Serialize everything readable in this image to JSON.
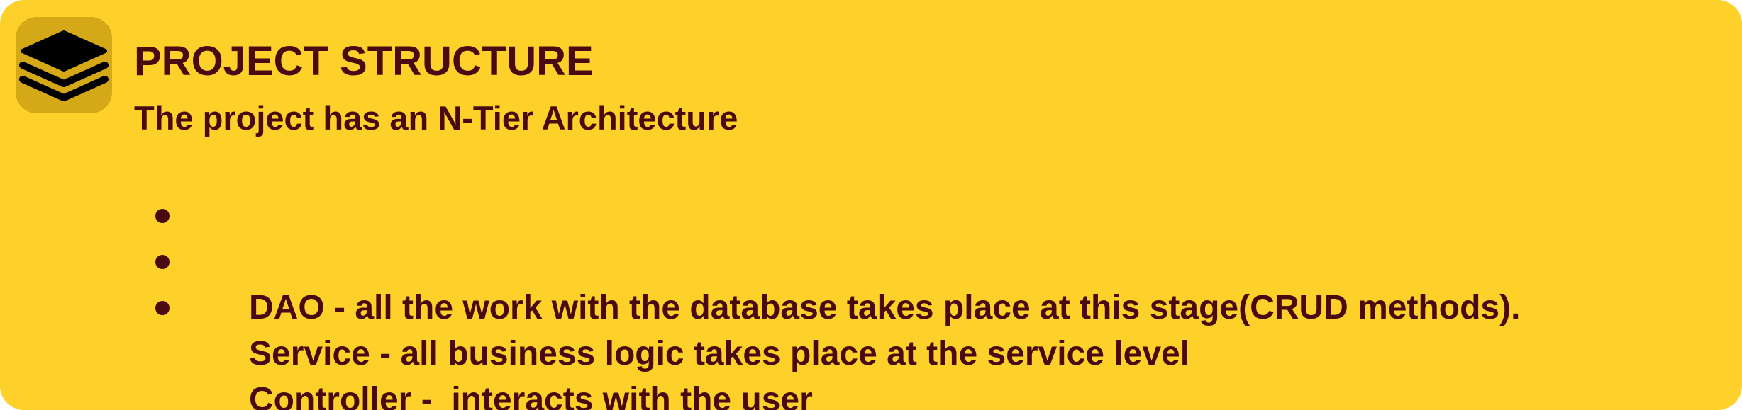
{
  "card": {
    "title": "PROJECT STRUCTURE",
    "subtitle": "The project has an N-Tier Architecture",
    "icon": "layers-icon",
    "bullets": [
      {
        "text": "DAO - all the work with the database takes place at this stage(CRUD methods)."
      },
      {
        "text": "Service - all business logic takes place at the service level"
      },
      {
        "text": "Controller -  interacts with the user"
      }
    ]
  },
  "colors": {
    "background": "#FDD02A",
    "icon_background": "#D4A817",
    "text": "#4A0A12",
    "icon_glyph": "#000000"
  }
}
